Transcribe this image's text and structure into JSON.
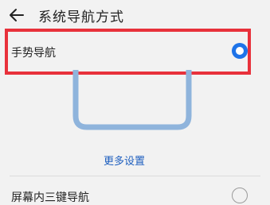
{
  "header": {
    "back_icon": "arrow-left-icon",
    "title": "系统导航方式"
  },
  "options": [
    {
      "label": "手势导航",
      "selected": true
    },
    {
      "label": "屏幕内三键导航",
      "selected": false
    }
  ],
  "more_settings": "更多设置",
  "colors": {
    "accent": "#1e73e8",
    "link": "#1e5fbf",
    "highlight": "#e8313b",
    "illustration": "#8fb4dc",
    "background": "#f2f2f2"
  }
}
